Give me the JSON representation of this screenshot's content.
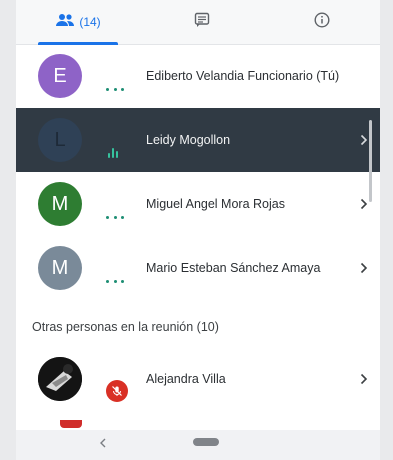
{
  "tabs": {
    "people_count": "(14)",
    "chat_icon": "chat-bubble-icon",
    "info_icon": "info-icon"
  },
  "participants": [
    {
      "initial": "E",
      "name": "Ediberto Velandia Funcionario (Tú)",
      "avatar_color": "#8e63c7"
    },
    {
      "initial": "L",
      "name": "Leidy Mogollon",
      "avatar_color": "#2f4156"
    },
    {
      "initial": "M",
      "name": "Miguel Angel Mora Rojas",
      "avatar_color": "#2e7d32"
    },
    {
      "initial": "M",
      "name": "Mario Esteban Sánchez Amaya",
      "avatar_color": "#7a8a99"
    }
  ],
  "others": {
    "title": "Otras personas en la reunión (10)",
    "people": [
      {
        "name": "Alejandra Villa"
      }
    ]
  },
  "colors": {
    "accent": "#1a73e8",
    "speaking": "#36c29e",
    "muted": "#d93025",
    "active_row": "#303a44"
  }
}
